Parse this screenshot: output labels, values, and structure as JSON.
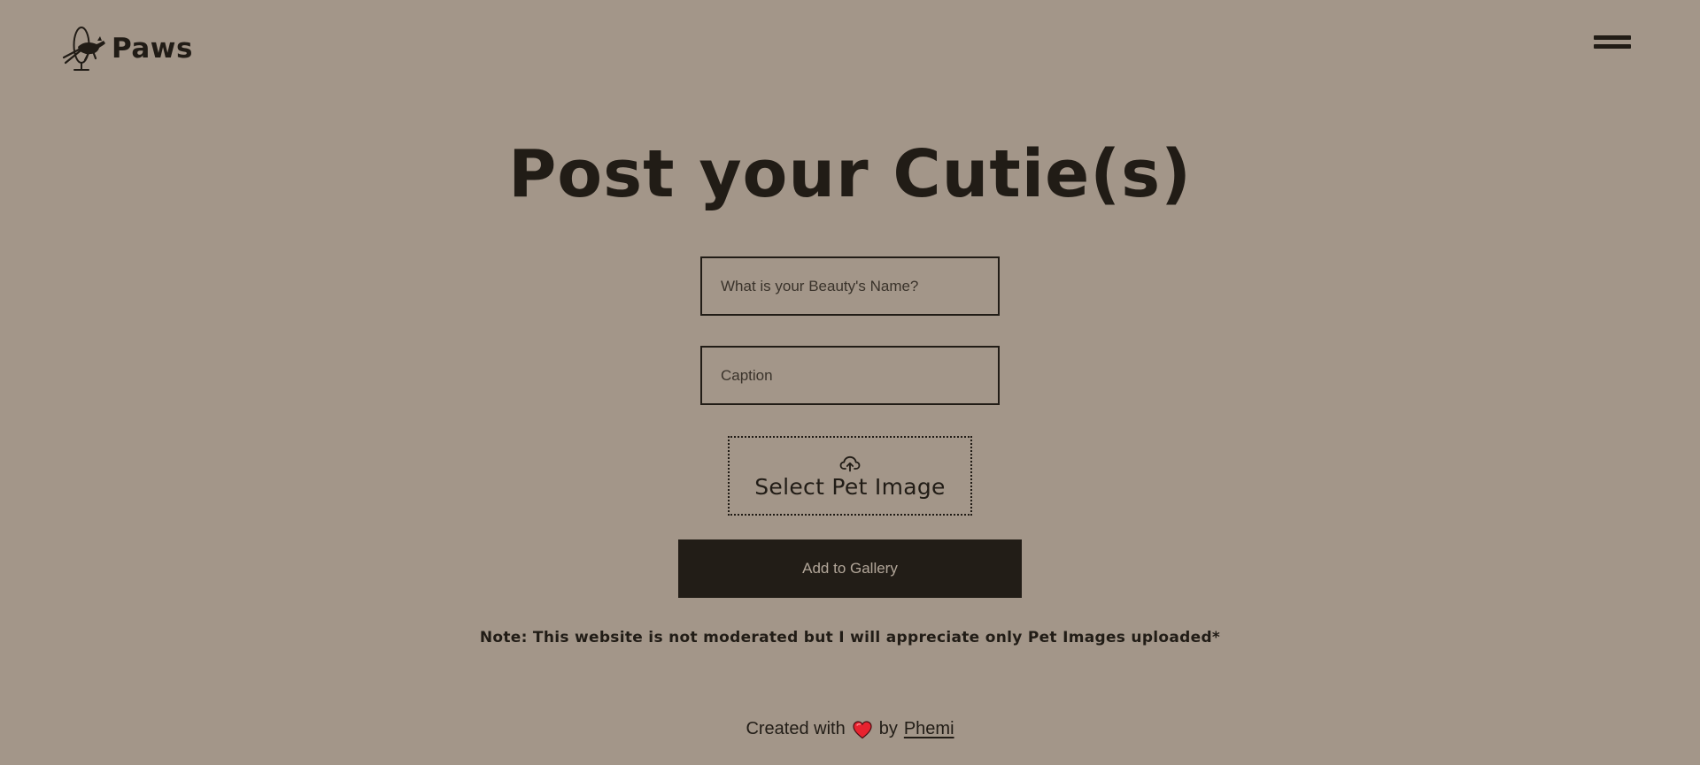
{
  "header": {
    "brand_name": "Paws",
    "logo_icon": "jumping-dog-hoop-icon",
    "menu_icon": "hamburger-menu-icon"
  },
  "main": {
    "title": "Post your Cutie(s)",
    "form": {
      "name_placeholder": "What is your Beauty's Name?",
      "name_value": "",
      "caption_placeholder": "Caption",
      "caption_value": "",
      "file_picker": {
        "icon": "cloud-upload-icon",
        "label": "Select Pet Image"
      },
      "submit_label": "Add to Gallery"
    },
    "note": "Note: This website is not moderated but I will appreciate only Pet Images uploaded*"
  },
  "footer": {
    "created_with": "Created with",
    "heart_icon": "red-heart-icon",
    "by": "by",
    "author": "Phemi"
  },
  "colors": {
    "background": "#a39689",
    "text": "#211c16",
    "button_background": "#221d17",
    "button_text": "#b2a699",
    "heart": "#e8232f"
  }
}
